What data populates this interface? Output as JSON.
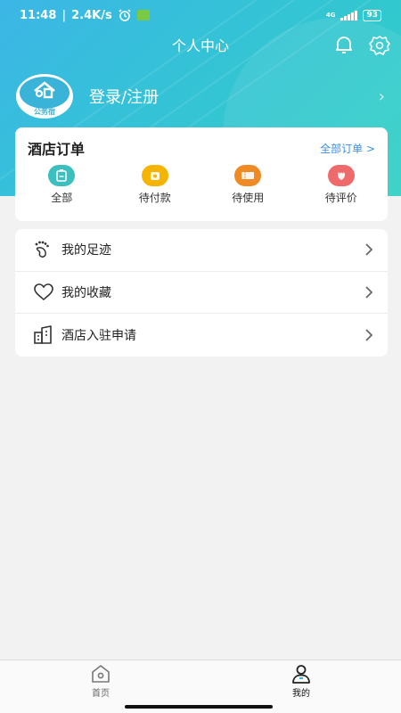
{
  "status_bar": {
    "time": "11:48",
    "speed": "2.4K/s",
    "network": "4G",
    "battery": "93"
  },
  "header": {
    "title": "个人中心",
    "bell_icon": "bell-icon",
    "settings_icon": "gear-icon"
  },
  "profile": {
    "avatar_label": "公务宿",
    "login_text": "登录/注册"
  },
  "orders": {
    "title": "酒店订单",
    "all_link": "全部订单 >",
    "items": [
      {
        "label": "全部",
        "icon": "clipboard-icon",
        "color": "#3bbfbf"
      },
      {
        "label": "待付款",
        "icon": "wallet-icon",
        "color": "#f4b400"
      },
      {
        "label": "待使用",
        "icon": "ticket-icon",
        "color": "#f08a24"
      },
      {
        "label": "待评价",
        "icon": "flower-icon",
        "color": "#ef6a6a"
      }
    ]
  },
  "menu": {
    "items": [
      {
        "label": "我的足迹",
        "icon": "footprint-icon"
      },
      {
        "label": "我的收藏",
        "icon": "heart-icon"
      },
      {
        "label": "酒店入驻申请",
        "icon": "building-icon"
      }
    ]
  },
  "tabbar": {
    "items": [
      {
        "label": "首页",
        "icon": "home-icon"
      },
      {
        "label": "我的",
        "icon": "user-icon"
      }
    ]
  },
  "colors": {
    "accent": "#3ab3d8",
    "link": "#3a8ee6",
    "background": "#f2f2f2"
  }
}
